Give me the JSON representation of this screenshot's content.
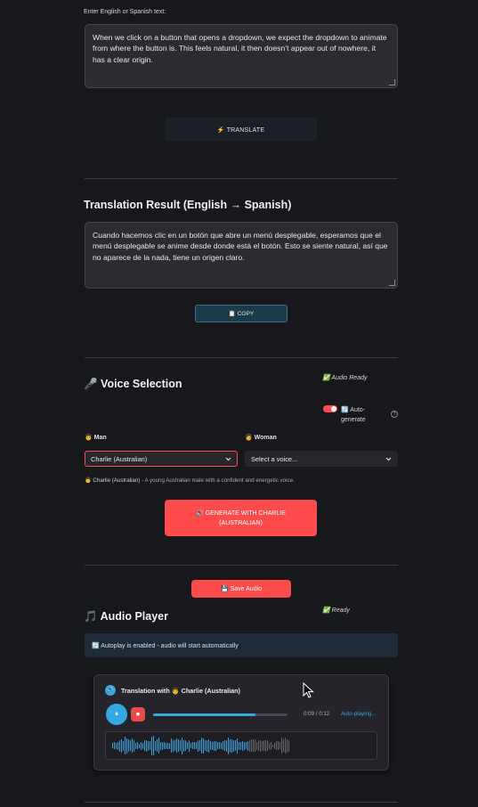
{
  "translate_section": {
    "input_label": "Enter English or Spanish text:",
    "input_text": "When we click on a button that opens a dropdown, we expect the dropdown to animate from where the button is. This feels natural, it then doesn’t appear out of nowhere, it has a clear origin.",
    "translate_button": "⚡ TRANSLATE"
  },
  "result_section": {
    "title": "Translation Result (English → Spanish)",
    "result_text": "Cuando hacemos clic en un botón que abre un menú desplegable, esperamos que el menú desplegable se anime desde donde está el botón. Esto se siente natural, así que no aparece de la nada, tiene un origen claro.",
    "copy_button": "📋 COPY"
  },
  "voice_section": {
    "title": "🎤 Voice Selection",
    "status": "✅ Audio Ready",
    "auto_generate_label_1": "🔄 Auto-",
    "auto_generate_label_2": "generate",
    "help_icon": "?",
    "man_label": "👨 Man",
    "woman_label": "👩 Woman",
    "man_selected": "Charlie (Australian)",
    "woman_placeholder": "Select a voice...",
    "description_name": "👨 Charlie (Australian)",
    "description_text": " - A young Australian male with a confident and energetic voice.",
    "generate_button_1": "🔊 GENERATE WITH CHARLIE",
    "generate_button_2": "(AUSTRALIAN)"
  },
  "audio_section": {
    "save_button": "💾 Save Audio",
    "title": "🎵 Audio Player",
    "status": "✅ Ready",
    "autoplay_notice": "🔄 Autoplay is enabled - audio will start automatically",
    "player_title": "Translation with 👨 Charlie (Australian)",
    "player_icon": "🔊",
    "pause_glyph": "⏸",
    "stop_glyph": "⏹",
    "time": "0:09 / 0:12",
    "progress": 0.76,
    "autoplay_status": "Auto-playing..."
  },
  "colors": {
    "accent_red": "#ff4b4b",
    "accent_blue": "#35a7e3",
    "background": "#17181c"
  }
}
